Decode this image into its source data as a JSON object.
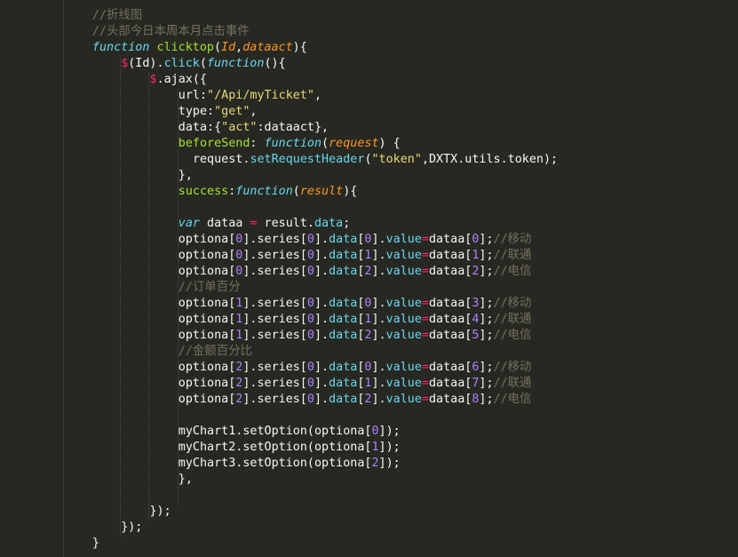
{
  "editor": {
    "language": "javascript",
    "theme_colors": {
      "background": "#272822",
      "text": "#f8f8f2",
      "comment": "#75715e",
      "keyword": "#66d9ef",
      "function": "#a6e22e",
      "parameter": "#fd971f",
      "string": "#e6db74",
      "number": "#ae81ff",
      "operator": "#f92672"
    },
    "lines": [
      {
        "indent": 3,
        "tokens": [
          {
            "t": "//折线图",
            "c": "comment"
          }
        ]
      },
      {
        "indent": 3,
        "tokens": [
          {
            "t": "//头部今日本周本月点击事件",
            "c": "comment"
          }
        ]
      },
      {
        "indent": 3,
        "tokens": [
          {
            "t": "function",
            "c": "kw"
          },
          {
            "t": " ",
            "c": "plain"
          },
          {
            "t": "clicktop",
            "c": "fn"
          },
          {
            "t": "(",
            "c": "plain"
          },
          {
            "t": "Id",
            "c": "param"
          },
          {
            "t": ",",
            "c": "plain"
          },
          {
            "t": "dataact",
            "c": "param"
          },
          {
            "t": "){",
            "c": "plain"
          }
        ]
      },
      {
        "indent": 4,
        "tokens": [
          {
            "t": "$",
            "c": "op"
          },
          {
            "t": "(Id).",
            "c": "plain"
          },
          {
            "t": "click",
            "c": "prop"
          },
          {
            "t": "(",
            "c": "plain"
          },
          {
            "t": "function",
            "c": "kw"
          },
          {
            "t": "(){",
            "c": "plain"
          }
        ]
      },
      {
        "indent": 5,
        "tokens": [
          {
            "t": "$",
            "c": "op"
          },
          {
            "t": ".ajax({",
            "c": "plain"
          }
        ]
      },
      {
        "indent": 6,
        "tokens": [
          {
            "t": "url:",
            "c": "plain"
          },
          {
            "t": "\"/Api/myTicket\"",
            "c": "str"
          },
          {
            "t": ",",
            "c": "plain"
          }
        ]
      },
      {
        "indent": 6,
        "tokens": [
          {
            "t": "type:",
            "c": "plain"
          },
          {
            "t": "\"get\"",
            "c": "str"
          },
          {
            "t": ",",
            "c": "plain"
          }
        ]
      },
      {
        "indent": 6,
        "tokens": [
          {
            "t": "data:{",
            "c": "plain"
          },
          {
            "t": "\"act\"",
            "c": "str"
          },
          {
            "t": ":dataact},",
            "c": "plain"
          }
        ]
      },
      {
        "indent": 6,
        "tokens": [
          {
            "t": "beforeSend",
            "c": "fn"
          },
          {
            "t": ": ",
            "c": "plain"
          },
          {
            "t": "function",
            "c": "kw"
          },
          {
            "t": "(",
            "c": "plain"
          },
          {
            "t": "request",
            "c": "param"
          },
          {
            "t": ") {",
            "c": "plain"
          }
        ]
      },
      {
        "indent": 6.5,
        "tokens": [
          {
            "t": "request.",
            "c": "plain"
          },
          {
            "t": "setRequestHeader",
            "c": "prop"
          },
          {
            "t": "(",
            "c": "plain"
          },
          {
            "t": "\"token\"",
            "c": "str"
          },
          {
            "t": ",DXTX.utils.token);",
            "c": "plain"
          }
        ]
      },
      {
        "indent": 6,
        "tokens": [
          {
            "t": "},",
            "c": "plain"
          }
        ]
      },
      {
        "indent": 6,
        "tokens": [
          {
            "t": "success",
            "c": "fn"
          },
          {
            "t": ":",
            "c": "plain"
          },
          {
            "t": "function",
            "c": "kw"
          },
          {
            "t": "(",
            "c": "plain"
          },
          {
            "t": "result",
            "c": "param"
          },
          {
            "t": "){",
            "c": "plain"
          }
        ]
      },
      {
        "indent": 6,
        "tokens": []
      },
      {
        "indent": 6,
        "tokens": [
          {
            "t": "var",
            "c": "kw"
          },
          {
            "t": " dataa ",
            "c": "plain"
          },
          {
            "t": "=",
            "c": "op"
          },
          {
            "t": " result.",
            "c": "plain"
          },
          {
            "t": "data",
            "c": "prop"
          },
          {
            "t": ";",
            "c": "plain"
          }
        ]
      },
      {
        "indent": 6,
        "tokens": [
          {
            "t": "optiona[",
            "c": "plain"
          },
          {
            "t": "0",
            "c": "num"
          },
          {
            "t": "].series[",
            "c": "plain"
          },
          {
            "t": "0",
            "c": "num"
          },
          {
            "t": "].",
            "c": "plain"
          },
          {
            "t": "data",
            "c": "prop"
          },
          {
            "t": "[",
            "c": "plain"
          },
          {
            "t": "0",
            "c": "num"
          },
          {
            "t": "].",
            "c": "plain"
          },
          {
            "t": "value",
            "c": "prop"
          },
          {
            "t": "=",
            "c": "op"
          },
          {
            "t": "dataa[",
            "c": "plain"
          },
          {
            "t": "0",
            "c": "num"
          },
          {
            "t": "];",
            "c": "plain"
          },
          {
            "t": "//移动",
            "c": "comment"
          }
        ]
      },
      {
        "indent": 6,
        "tokens": [
          {
            "t": "optiona[",
            "c": "plain"
          },
          {
            "t": "0",
            "c": "num"
          },
          {
            "t": "].series[",
            "c": "plain"
          },
          {
            "t": "0",
            "c": "num"
          },
          {
            "t": "].",
            "c": "plain"
          },
          {
            "t": "data",
            "c": "prop"
          },
          {
            "t": "[",
            "c": "plain"
          },
          {
            "t": "1",
            "c": "num"
          },
          {
            "t": "].",
            "c": "plain"
          },
          {
            "t": "value",
            "c": "prop"
          },
          {
            "t": "=",
            "c": "op"
          },
          {
            "t": "dataa[",
            "c": "plain"
          },
          {
            "t": "1",
            "c": "num"
          },
          {
            "t": "];",
            "c": "plain"
          },
          {
            "t": "//联通",
            "c": "comment"
          }
        ]
      },
      {
        "indent": 6,
        "tokens": [
          {
            "t": "optiona[",
            "c": "plain"
          },
          {
            "t": "0",
            "c": "num"
          },
          {
            "t": "].series[",
            "c": "plain"
          },
          {
            "t": "0",
            "c": "num"
          },
          {
            "t": "].",
            "c": "plain"
          },
          {
            "t": "data",
            "c": "prop"
          },
          {
            "t": "[",
            "c": "plain"
          },
          {
            "t": "2",
            "c": "num"
          },
          {
            "t": "].",
            "c": "plain"
          },
          {
            "t": "value",
            "c": "prop"
          },
          {
            "t": "=",
            "c": "op"
          },
          {
            "t": "dataa[",
            "c": "plain"
          },
          {
            "t": "2",
            "c": "num"
          },
          {
            "t": "];",
            "c": "plain"
          },
          {
            "t": "//电信",
            "c": "comment"
          }
        ]
      },
      {
        "indent": 6,
        "tokens": [
          {
            "t": "//订单百分",
            "c": "comment"
          }
        ]
      },
      {
        "indent": 6,
        "tokens": [
          {
            "t": "optiona[",
            "c": "plain"
          },
          {
            "t": "1",
            "c": "num"
          },
          {
            "t": "].series[",
            "c": "plain"
          },
          {
            "t": "0",
            "c": "num"
          },
          {
            "t": "].",
            "c": "plain"
          },
          {
            "t": "data",
            "c": "prop"
          },
          {
            "t": "[",
            "c": "plain"
          },
          {
            "t": "0",
            "c": "num"
          },
          {
            "t": "].",
            "c": "plain"
          },
          {
            "t": "value",
            "c": "prop"
          },
          {
            "t": "=",
            "c": "op"
          },
          {
            "t": "dataa[",
            "c": "plain"
          },
          {
            "t": "3",
            "c": "num"
          },
          {
            "t": "];",
            "c": "plain"
          },
          {
            "t": "//移动",
            "c": "comment"
          }
        ]
      },
      {
        "indent": 6,
        "tokens": [
          {
            "t": "optiona[",
            "c": "plain"
          },
          {
            "t": "1",
            "c": "num"
          },
          {
            "t": "].series[",
            "c": "plain"
          },
          {
            "t": "0",
            "c": "num"
          },
          {
            "t": "].",
            "c": "plain"
          },
          {
            "t": "data",
            "c": "prop"
          },
          {
            "t": "[",
            "c": "plain"
          },
          {
            "t": "1",
            "c": "num"
          },
          {
            "t": "].",
            "c": "plain"
          },
          {
            "t": "value",
            "c": "prop"
          },
          {
            "t": "=",
            "c": "op"
          },
          {
            "t": "dataa[",
            "c": "plain"
          },
          {
            "t": "4",
            "c": "num"
          },
          {
            "t": "];",
            "c": "plain"
          },
          {
            "t": "//联通",
            "c": "comment"
          }
        ]
      },
      {
        "indent": 6,
        "tokens": [
          {
            "t": "optiona[",
            "c": "plain"
          },
          {
            "t": "1",
            "c": "num"
          },
          {
            "t": "].series[",
            "c": "plain"
          },
          {
            "t": "0",
            "c": "num"
          },
          {
            "t": "].",
            "c": "plain"
          },
          {
            "t": "data",
            "c": "prop"
          },
          {
            "t": "[",
            "c": "plain"
          },
          {
            "t": "2",
            "c": "num"
          },
          {
            "t": "].",
            "c": "plain"
          },
          {
            "t": "value",
            "c": "prop"
          },
          {
            "t": "=",
            "c": "op"
          },
          {
            "t": "dataa[",
            "c": "plain"
          },
          {
            "t": "5",
            "c": "num"
          },
          {
            "t": "];",
            "c": "plain"
          },
          {
            "t": "//电信",
            "c": "comment"
          }
        ]
      },
      {
        "indent": 6,
        "tokens": [
          {
            "t": "//金额百分比",
            "c": "comment"
          }
        ]
      },
      {
        "indent": 6,
        "tokens": [
          {
            "t": "optiona[",
            "c": "plain"
          },
          {
            "t": "2",
            "c": "num"
          },
          {
            "t": "].series[",
            "c": "plain"
          },
          {
            "t": "0",
            "c": "num"
          },
          {
            "t": "].",
            "c": "plain"
          },
          {
            "t": "data",
            "c": "prop"
          },
          {
            "t": "[",
            "c": "plain"
          },
          {
            "t": "0",
            "c": "num"
          },
          {
            "t": "].",
            "c": "plain"
          },
          {
            "t": "value",
            "c": "prop"
          },
          {
            "t": "=",
            "c": "op"
          },
          {
            "t": "dataa[",
            "c": "plain"
          },
          {
            "t": "6",
            "c": "num"
          },
          {
            "t": "];",
            "c": "plain"
          },
          {
            "t": "//移动",
            "c": "comment"
          }
        ]
      },
      {
        "indent": 6,
        "tokens": [
          {
            "t": "optiona[",
            "c": "plain"
          },
          {
            "t": "2",
            "c": "num"
          },
          {
            "t": "].series[",
            "c": "plain"
          },
          {
            "t": "0",
            "c": "num"
          },
          {
            "t": "].",
            "c": "plain"
          },
          {
            "t": "data",
            "c": "prop"
          },
          {
            "t": "[",
            "c": "plain"
          },
          {
            "t": "1",
            "c": "num"
          },
          {
            "t": "].",
            "c": "plain"
          },
          {
            "t": "value",
            "c": "prop"
          },
          {
            "t": "=",
            "c": "op"
          },
          {
            "t": "dataa[",
            "c": "plain"
          },
          {
            "t": "7",
            "c": "num"
          },
          {
            "t": "];",
            "c": "plain"
          },
          {
            "t": "//联通",
            "c": "comment"
          }
        ]
      },
      {
        "indent": 6,
        "tokens": [
          {
            "t": "optiona[",
            "c": "plain"
          },
          {
            "t": "2",
            "c": "num"
          },
          {
            "t": "].series[",
            "c": "plain"
          },
          {
            "t": "0",
            "c": "num"
          },
          {
            "t": "].",
            "c": "plain"
          },
          {
            "t": "data",
            "c": "prop"
          },
          {
            "t": "[",
            "c": "plain"
          },
          {
            "t": "2",
            "c": "num"
          },
          {
            "t": "].",
            "c": "plain"
          },
          {
            "t": "value",
            "c": "prop"
          },
          {
            "t": "=",
            "c": "op"
          },
          {
            "t": "dataa[",
            "c": "plain"
          },
          {
            "t": "8",
            "c": "num"
          },
          {
            "t": "];",
            "c": "plain"
          },
          {
            "t": "//电信",
            "c": "comment"
          }
        ]
      },
      {
        "indent": 6,
        "tokens": []
      },
      {
        "indent": 6,
        "tokens": [
          {
            "t": "myChart1.setOption(optiona[",
            "c": "plain"
          },
          {
            "t": "0",
            "c": "num"
          },
          {
            "t": "]);",
            "c": "plain"
          }
        ]
      },
      {
        "indent": 6,
        "tokens": [
          {
            "t": "myChart2.setOption(optiona[",
            "c": "plain"
          },
          {
            "t": "1",
            "c": "num"
          },
          {
            "t": "]);",
            "c": "plain"
          }
        ]
      },
      {
        "indent": 6,
        "tokens": [
          {
            "t": "myChart3.setOption(optiona[",
            "c": "plain"
          },
          {
            "t": "2",
            "c": "num"
          },
          {
            "t": "]);",
            "c": "plain"
          }
        ]
      },
      {
        "indent": 6,
        "tokens": [
          {
            "t": "},",
            "c": "plain"
          }
        ]
      },
      {
        "indent": 5,
        "tokens": []
      },
      {
        "indent": 5,
        "tokens": [
          {
            "t": "});",
            "c": "plain"
          }
        ]
      },
      {
        "indent": 4,
        "tokens": [
          {
            "t": "});",
            "c": "plain"
          }
        ]
      },
      {
        "indent": 3,
        "tokens": [
          {
            "t": "}",
            "c": "plain"
          }
        ]
      }
    ]
  }
}
